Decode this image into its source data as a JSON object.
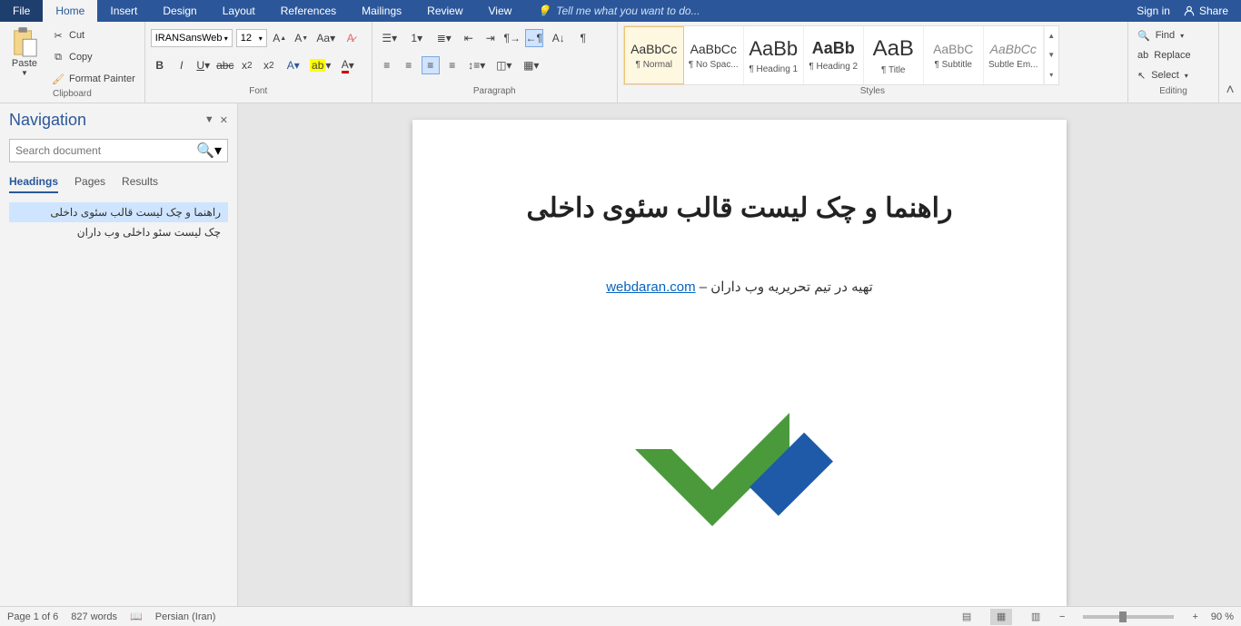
{
  "tabs": {
    "file": "File",
    "list": [
      "Home",
      "Insert",
      "Design",
      "Layout",
      "References",
      "Mailings",
      "Review",
      "View"
    ],
    "active": "Home",
    "tellme": "Tell me what you want to do...",
    "signin": "Sign in",
    "share": "Share"
  },
  "ribbon": {
    "clipboard": {
      "label": "Clipboard",
      "paste": "Paste",
      "cut": "Cut",
      "copy": "Copy",
      "formatpainter": "Format Painter"
    },
    "font": {
      "label": "Font",
      "name": "IRANSansWeb",
      "size": "12"
    },
    "paragraph": {
      "label": "Paragraph"
    },
    "styles": {
      "label": "Styles",
      "items": [
        {
          "preview": "AaBbCc",
          "name": "¶ Normal",
          "sel": true
        },
        {
          "preview": "AaBbCc",
          "name": "¶ No Spac..."
        },
        {
          "preview": "AaBb",
          "name": "¶ Heading 1",
          "big": true
        },
        {
          "preview": "AaBb",
          "name": "¶ Heading 2",
          "bold": true
        },
        {
          "preview": "AaB",
          "name": "¶ Title",
          "huge": true
        },
        {
          "preview": "AaBbC",
          "name": "¶ Subtitle"
        },
        {
          "preview": "AaBbCc",
          "name": "Subtle Em...",
          "italic": true
        }
      ]
    },
    "editing": {
      "label": "Editing",
      "find": "Find",
      "replace": "Replace",
      "select": "Select"
    }
  },
  "navpane": {
    "title": "Navigation",
    "search_placeholder": "Search document",
    "tabs": [
      "Headings",
      "Pages",
      "Results"
    ],
    "active_tab": "Headings",
    "items": [
      {
        "text": "راهنما و چک لیست قالب سئوی داخلی",
        "selected": true
      },
      {
        "text": "چک لیست سئو داخلی وب داران",
        "selected": false
      }
    ]
  },
  "document": {
    "title": "راهنما و چک لیست قالب سئوی داخلی",
    "subline_text": "تهیه در تیم تحریریه وب داران – ",
    "subline_link": "webdaran.com"
  },
  "status": {
    "page": "Page 1 of 6",
    "words": "827 words",
    "lang": "Persian (Iran)",
    "zoom": "90 %"
  }
}
